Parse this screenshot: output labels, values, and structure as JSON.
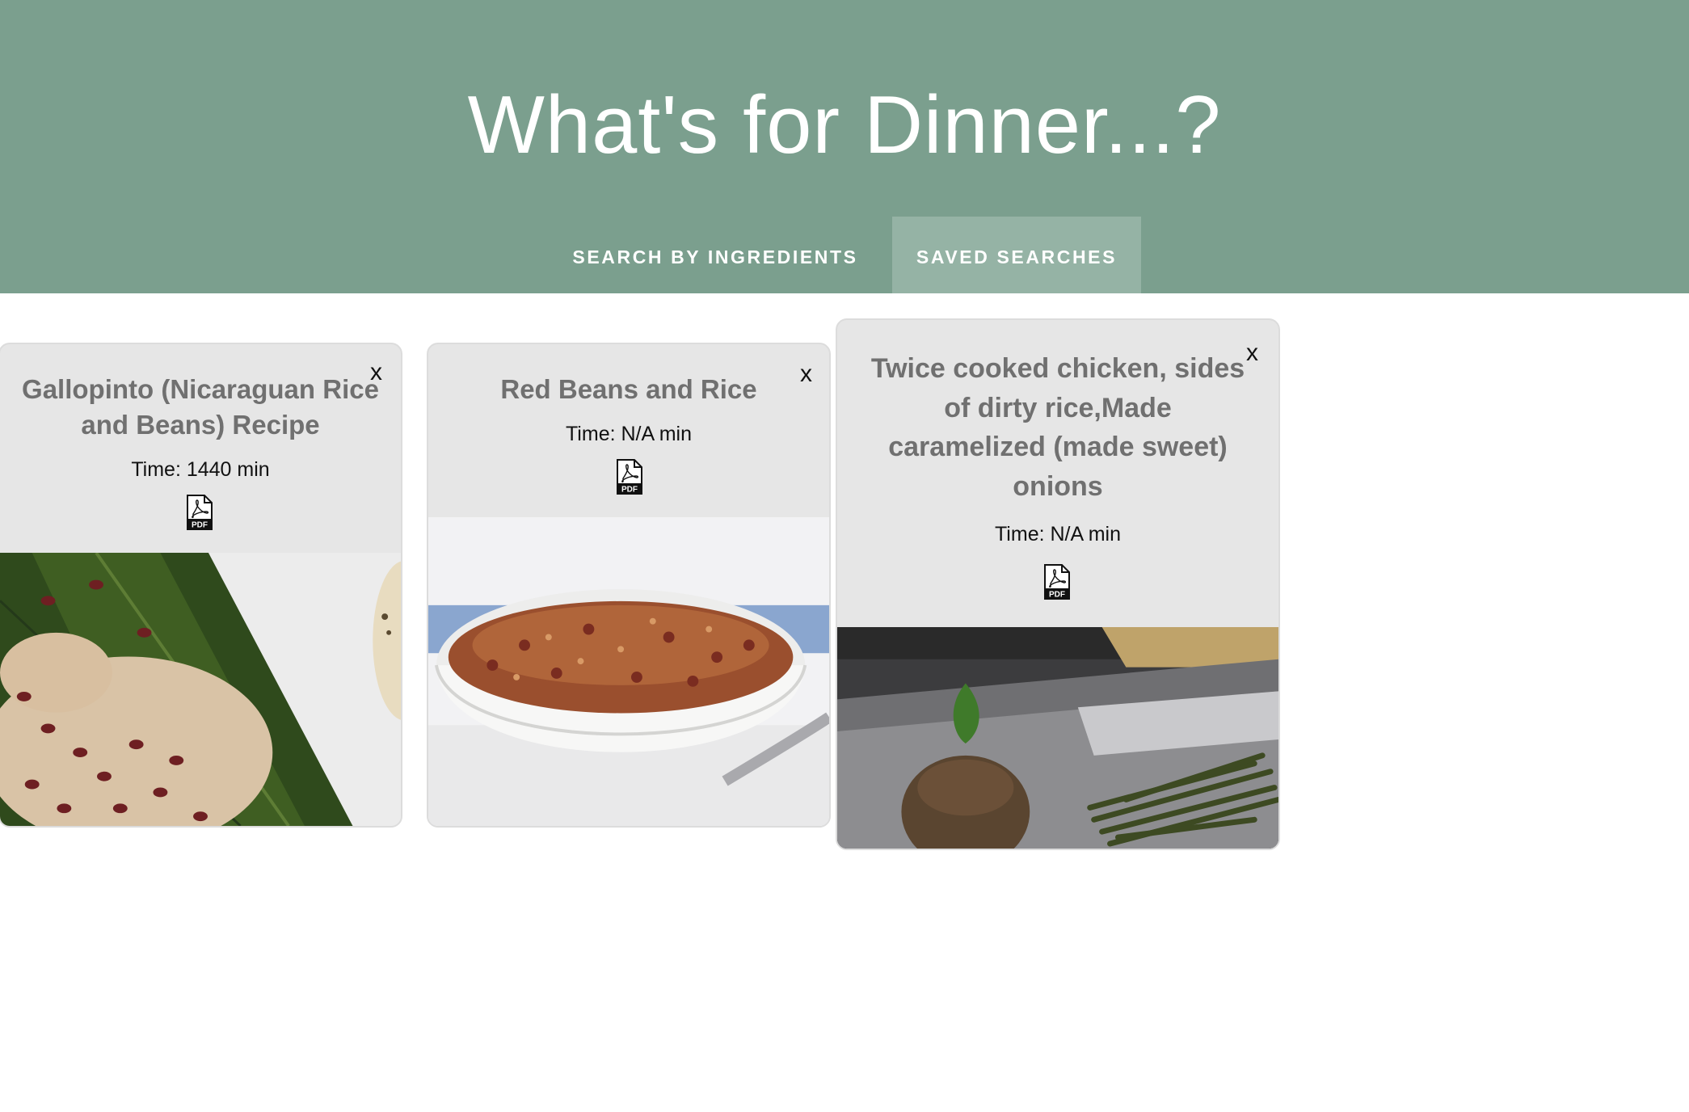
{
  "header": {
    "title": "What's for Dinner...?",
    "background": "#7b9f8e"
  },
  "nav": {
    "tabs": [
      {
        "label": "SEARCH BY INGREDIENTS",
        "active": false
      },
      {
        "label": "SAVED SEARCHES",
        "active": true
      }
    ]
  },
  "cards": [
    {
      "title": "Gallopinto (Nicaraguan Rice and Beans) Recipe",
      "time": "Time: 1440 min",
      "close": "x",
      "pdf_icon": "pdf-icon",
      "image": "rice-and-beans-on-banana-leaf"
    },
    {
      "title": "Red Beans and Rice",
      "time": "Time: N/A min",
      "close": "x",
      "pdf_icon": "pdf-icon",
      "image": "bowl-of-red-beans-and-rice"
    },
    {
      "title": "Twice cooked chicken, sides of dirty rice,Made caramelized (made sweet) onions",
      "time": "Time: N/A min",
      "close": "x",
      "pdf_icon": "pdf-icon",
      "image": "plated-dirty-rice-and-green-beans"
    }
  ]
}
